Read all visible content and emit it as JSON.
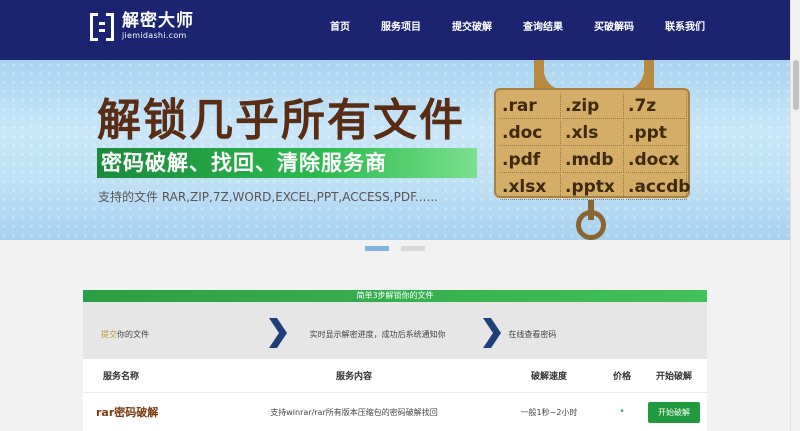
{
  "header": {
    "logo_name": "解密大师",
    "logo_domain": "jiemidashi.com",
    "nav": [
      "首页",
      "服务项目",
      "提交破解",
      "查询结果",
      "买破解码",
      "联系我们"
    ]
  },
  "banner": {
    "headline": "解锁几乎所有文件",
    "subheadline": "密码破解、找回、清除服务商",
    "supported": "支持的文件 RAR,ZIP,7Z,WORD,EXCEL,PPT,ACCESS,PDF......",
    "extensions": [
      ".rar",
      ".zip",
      ".7z",
      ".doc",
      ".xls",
      ".ppt",
      ".pdf",
      ".mdb",
      ".docx",
      ".xlsx",
      ".pptx",
      ".accdb"
    ]
  },
  "steps": {
    "title": "简单3步解锁你的文件",
    "step1_highlight": "提交",
    "step1_rest": "你的文件",
    "step2": "实时显示解密进度，成功后系统通知你",
    "step3": "在线查看密码"
  },
  "table": {
    "headers": [
      "服务名称",
      "服务内容",
      "破解速度",
      "价格",
      "开始破解"
    ],
    "rows": [
      {
        "name": "rar密码破解",
        "content": "支持winrar/rar所有版本压缩包的密码破解找回",
        "speed": "一般1秒~2小时",
        "price": "•",
        "action": "开始破解"
      }
    ]
  },
  "colors": {
    "header_bg": "#1a2471",
    "accent_green": "#1f9a3d",
    "brand_brown": "#5a2c14"
  }
}
